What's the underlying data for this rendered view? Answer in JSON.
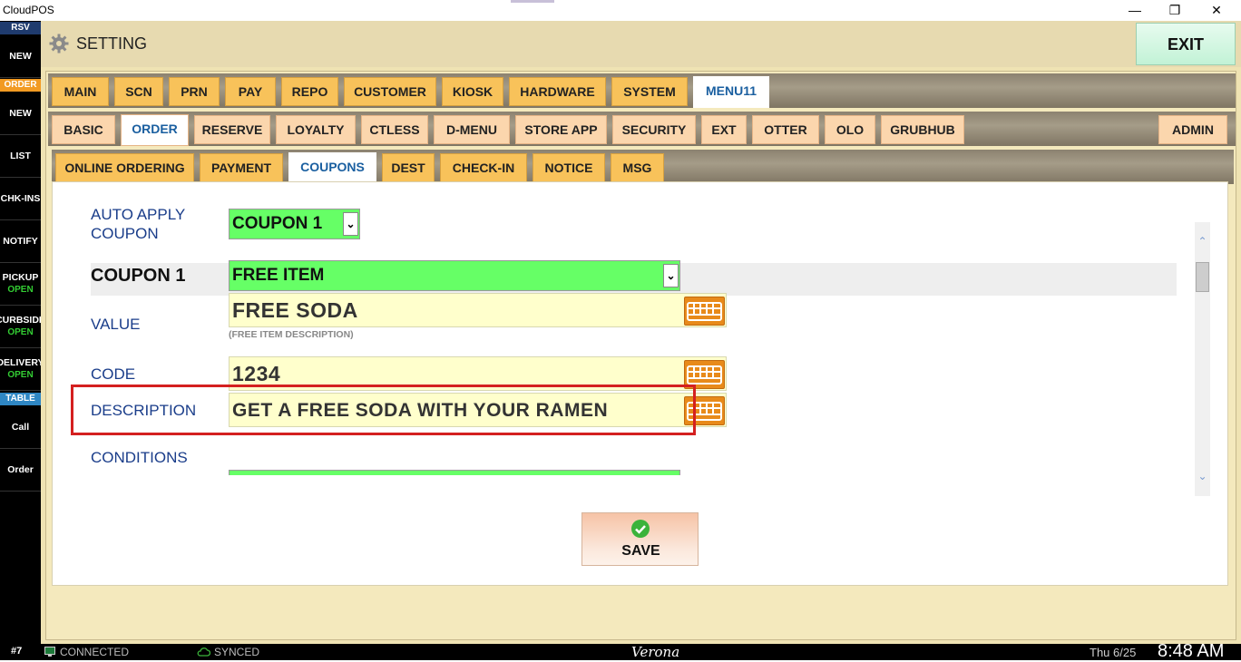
{
  "window": {
    "title": "CloudPOS",
    "minimize": "—",
    "restore": "❐",
    "close": "✕"
  },
  "sidebar": {
    "cat_rsv": "RSV",
    "rsv_new": "NEW",
    "cat_order": "ORDER",
    "order_new": "NEW",
    "list": "LIST",
    "chkins": "CHK-INS",
    "notify": "NOTIFY",
    "pickup": "PICKUP",
    "pickup_status": "OPEN",
    "curbside": "CURBSIDE",
    "curbside_status": "OPEN",
    "delivery": "DELIVERY",
    "delivery_status": "OPEN",
    "cat_table": "TABLE",
    "call": "Call",
    "order": "Order",
    "colors": {
      "rsv": "#1f3b6e",
      "order": "#f29a22",
      "table": "#2f87c4",
      "open": "#33cc33"
    }
  },
  "header": {
    "title": "SETTING",
    "exit_label": "EXIT",
    "icon": "gear-icon"
  },
  "tabs_row1": [
    "MAIN",
    "SCN",
    "PRN",
    "PAY",
    "REPO",
    "CUSTOMER",
    "KIOSK",
    "HARDWARE",
    "SYSTEM",
    "MENU11"
  ],
  "tabs_row2": [
    "BASIC",
    "ORDER",
    "RESERVE",
    "LOYALTY",
    "CTLESS",
    "D-MENU",
    "STORE APP",
    "SECURITY",
    "EXT",
    "OTTER",
    "OLO",
    "GRUBHUB",
    "ADMIN"
  ],
  "tabs_row3": [
    "ONLINE ORDERING",
    "PAYMENT",
    "COUPONS",
    "DEST",
    "CHECK-IN",
    "NOTICE",
    "MSG"
  ],
  "active_tabs": {
    "row1": "MENU11",
    "row2": "ORDER",
    "row3": "COUPONS"
  },
  "form": {
    "auto_apply_label_line1": "AUTO APPLY",
    "auto_apply_label_line2": "COUPON",
    "auto_apply_value": "COUPON 1",
    "coupon_label": "COUPON 1",
    "coupon_type_value": "FREE ITEM",
    "value_label": "VALUE",
    "value_value": "FREE SODA",
    "value_hint": "(FREE ITEM DESCRIPTION)",
    "code_label": "CODE",
    "code_value": "1234",
    "description_label": "DESCRIPTION",
    "description_value": "GET A FREE SODA WITH YOUR RAMEN",
    "conditions_label": "CONDITIONS"
  },
  "save_label": "SAVE",
  "status": {
    "station": "#7",
    "connection": "CONNECTED",
    "sync": "SYNCED",
    "store_name": "Verona",
    "date": "Thu 6/25",
    "time": "8:48 AM"
  }
}
